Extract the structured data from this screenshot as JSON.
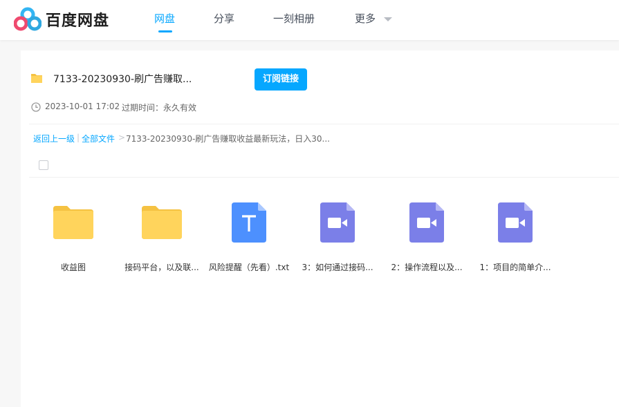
{
  "header": {
    "logo_text": "百度网盘",
    "nav": [
      {
        "label": "网盘",
        "active": true
      },
      {
        "label": "分享",
        "active": false
      },
      {
        "label": "一刻相册",
        "active": false
      },
      {
        "label": "更多",
        "active": false
      }
    ]
  },
  "share": {
    "title": "7133-20230930-刷广告赚取...",
    "subscribe_label": "订阅链接",
    "time": "2023-10-01 17:02",
    "expire": "过期时间：永久有效"
  },
  "breadcrumb": {
    "back": "返回上一级",
    "sep1": "|",
    "all": "全部文件",
    "sep2": ">",
    "current": "7133-20230930-刷广告赚取收益最新玩法，日入30..."
  },
  "files": [
    {
      "name": "收益图",
      "type": "folder"
    },
    {
      "name": "接码平台，以及联...",
      "type": "folder"
    },
    {
      "name": "风险提醒（先看）.txt",
      "type": "txt"
    },
    {
      "name": "3：如何通过接码...",
      "type": "video"
    },
    {
      "name": "2：操作流程以及...",
      "type": "video"
    },
    {
      "name": "1：项目的简单介...",
      "type": "video"
    }
  ],
  "colors": {
    "accent": "#06a7ff",
    "folder": "#ffd45c",
    "txt": "#4d90fe",
    "video": "#7b7fe8"
  }
}
